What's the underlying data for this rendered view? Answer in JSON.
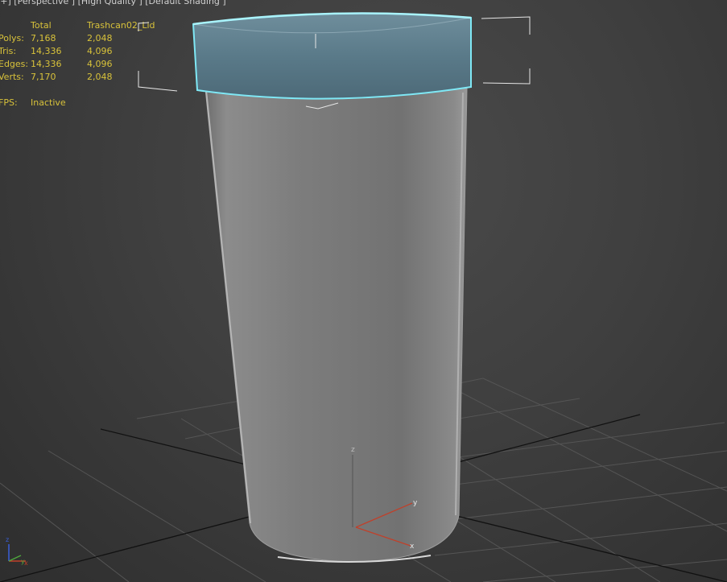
{
  "viewport": {
    "label": "[+] [Perspective ] [High Quality ] [Default Shading ]"
  },
  "stats": {
    "total_header": "Total",
    "object_header": "Trashcan02_Lid",
    "rows": [
      {
        "label": "Polys:",
        "total": "7,168",
        "object": "2,048"
      },
      {
        "label": "Tris:",
        "total": "14,336",
        "object": "4,096"
      },
      {
        "label": "Edges:",
        "total": "14,336",
        "object": "4,096"
      },
      {
        "label": "Verts:",
        "total": "7,170",
        "object": "2,048"
      }
    ],
    "fps_label": "FPS:",
    "fps_value": "Inactive"
  },
  "axes": {
    "x": "x",
    "y": "y",
    "z": "z"
  },
  "colors": {
    "selection_highlight": "#7fe8f5",
    "lid": "#5d7d8c",
    "stats_text": "#d8c23a",
    "grid_line": "#555555",
    "grid_axis": "#111111",
    "axis_x": "#c0402a",
    "axis_y": "#4fa83c",
    "axis_z": "#3a5fd8"
  }
}
